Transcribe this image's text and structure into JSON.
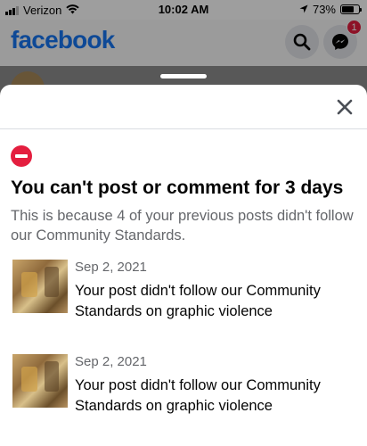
{
  "status_bar": {
    "carrier": "Verizon",
    "time": "10:02 AM",
    "battery": "73%",
    "battery_level": 0.73
  },
  "header": {
    "logo": "facebook",
    "search_icon": "search-icon",
    "messenger_icon": "messenger-icon",
    "messenger_badge": "1",
    "brand_color": "#1877f2"
  },
  "sheet": {
    "close_icon": "close-icon",
    "status_icon": "stop-icon",
    "title": "You can't post or comment for 3 days",
    "description": "This is because 4 of your previous posts didn't follow our Community Standards.",
    "items": [
      {
        "date": "Sep 2, 2021",
        "text": "Your post didn't follow our Community Standards on graphic violence"
      },
      {
        "date": "Sep 2, 2021",
        "text": "Your post didn't follow our Community Standards on graphic violence"
      }
    ]
  }
}
